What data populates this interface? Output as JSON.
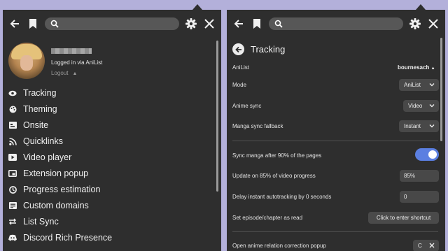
{
  "colors": {
    "background": "#b3b0da",
    "panel": "#2e2e2e",
    "accent": "#5b7fe1",
    "search": "#575757"
  },
  "left": {
    "topbar": {
      "back_icon": "arrow-left-icon",
      "bookmark_icon": "bookmark-icon",
      "search_icon": "search-icon",
      "settings_icon": "gear-icon",
      "close_icon": "close-icon",
      "search_value": ""
    },
    "profile": {
      "logged_in_text": "Logged in via AniList",
      "logout_label": "Logout"
    },
    "menu": [
      {
        "label": "Tracking",
        "icon": "eye-icon"
      },
      {
        "label": "Theming",
        "icon": "palette-icon"
      },
      {
        "label": "Onsite",
        "icon": "onsite-icon"
      },
      {
        "label": "Quicklinks",
        "icon": "rss-icon"
      },
      {
        "label": "Video player",
        "icon": "video-icon"
      },
      {
        "label": "Extension popup",
        "icon": "popup-icon"
      },
      {
        "label": "Progress estimation",
        "icon": "progress-icon"
      },
      {
        "label": "Custom domains",
        "icon": "domains-icon"
      },
      {
        "label": "List Sync",
        "icon": "sync-icon"
      },
      {
        "label": "Discord Rich Presence",
        "icon": "discord-icon"
      }
    ]
  },
  "right": {
    "title": "Tracking",
    "rows": {
      "anilist": {
        "label": "AniList",
        "value": "bournesach"
      },
      "mode": {
        "label": "Mode",
        "value": "AniList"
      },
      "anime_sync": {
        "label": "Anime sync",
        "value": "Video"
      },
      "manga_sync": {
        "label": "Manga sync fallback",
        "value": "Instant"
      },
      "sync_manga": {
        "label": "Sync manga after 90% of the pages",
        "enabled": true
      },
      "update_video": {
        "label": "Update on 85% of video progress",
        "value": "85%"
      },
      "delay": {
        "label": "Delay instant autotracking by 0 seconds",
        "value": "0"
      },
      "set_read": {
        "label": "Set episode/chapter as read",
        "button": "Click to enter shortcut"
      },
      "relation_popup": {
        "label": "Open anime relation correction popup"
      }
    }
  }
}
